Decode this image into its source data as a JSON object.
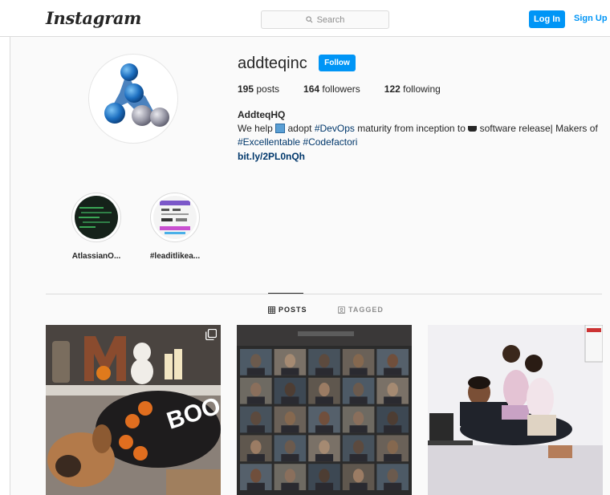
{
  "nav": {
    "logo": "Instagram",
    "search_placeholder": "Search",
    "login_label": "Log In",
    "signup_label": "Sign Up"
  },
  "profile": {
    "username": "addteqinc",
    "follow_label": "Follow",
    "posts_count": "195",
    "posts_label": " posts",
    "followers_count": "164",
    "followers_label": " followers",
    "following_count": "122",
    "following_label": " following",
    "full_name": "AddteqHQ",
    "bio": {
      "part1": "We help ",
      "part2": " adopt ",
      "hashtag_devops": "#DevOps",
      "part3": " maturity from inception to ",
      "part4": " software release| Makers of ",
      "hashtag_excellentable": "#Excellentable",
      "hashtag_codefactori": "#Codefactori"
    },
    "link": "bit.ly/2PL0nQh"
  },
  "highlights": [
    {
      "label": "AtlassianO..."
    },
    {
      "label": "#leaditlikea..."
    }
  ],
  "tabs": [
    {
      "label": "POSTS",
      "icon": "grid-icon",
      "active": true
    },
    {
      "label": "TAGGED",
      "icon": "tagged-icon",
      "active": false
    }
  ],
  "posts": [
    {
      "description_icon": "multi-image-icon"
    },
    {},
    {}
  ],
  "colors": {
    "accent": "#0095f6",
    "link": "#00376b",
    "text": "#262626",
    "muted": "#8e8e8e",
    "border": "#dbdbdb"
  }
}
